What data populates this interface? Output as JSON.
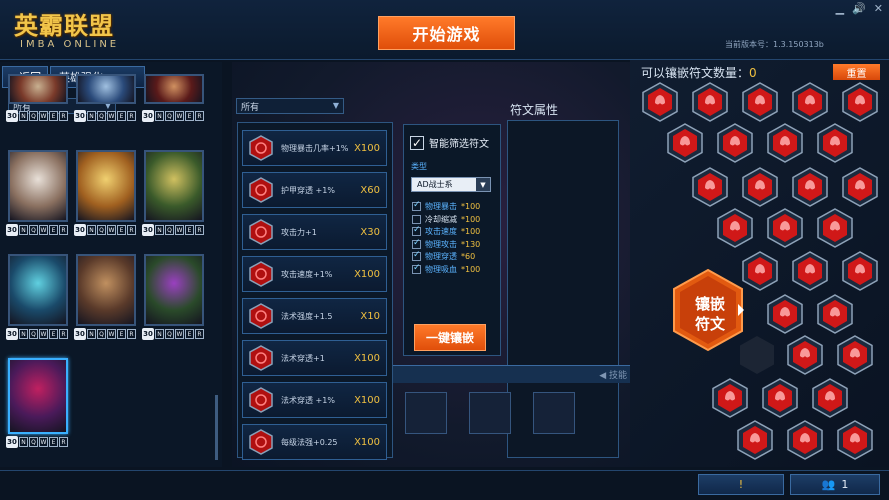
{
  "header": {
    "logo_title": "英霸联盟",
    "logo_sub": "IMBA ONLINE",
    "start_label": "开始游戏",
    "version": "当前版本号：1.3.150313b"
  },
  "nav": {
    "back_label": "返回",
    "tab_label": "英雄强化",
    "hero_filter": "所有"
  },
  "hero_keys": {
    "level": "30",
    "keys": [
      "N",
      "Q",
      "W",
      "E",
      "R"
    ]
  },
  "heroes": [
    {
      "name": "hero-1"
    },
    {
      "name": "hero-2"
    },
    {
      "name": "hero-3"
    },
    {
      "name": "hero-4"
    },
    {
      "name": "hero-5"
    },
    {
      "name": "hero-6"
    },
    {
      "name": "hero-7"
    },
    {
      "name": "hero-8"
    },
    {
      "name": "hero-9"
    },
    {
      "name": "hero-10"
    }
  ],
  "rune_filter": "所有",
  "runes": [
    {
      "name": "物理暴击几率+1%",
      "count": "X100"
    },
    {
      "name": "护甲穿透 +1%",
      "count": "X60"
    },
    {
      "name": "攻击力+1",
      "count": "X30"
    },
    {
      "name": "攻击速度+1%",
      "count": "X100"
    },
    {
      "name": "法术强度+1.5",
      "count": "X10"
    },
    {
      "name": "法术穿透+1",
      "count": "X100"
    },
    {
      "name": "法术穿透 +1%",
      "count": "X100"
    },
    {
      "name": "每级法强+0.25",
      "count": "X100"
    }
  ],
  "filter": {
    "smart_label": "智能筛选符文",
    "type_label": "类型",
    "type_value": "AD战士系",
    "options": [
      {
        "label": "物理暴击",
        "value": "*100",
        "checked": true
      },
      {
        "label": "冷却缩减",
        "value": "*100",
        "checked": false
      },
      {
        "label": "攻击速度",
        "value": "*100",
        "checked": true
      },
      {
        "label": "物理攻击",
        "value": "*130",
        "checked": true
      },
      {
        "label": "物理穿透",
        "value": "*60",
        "checked": true
      },
      {
        "label": "物理吸血",
        "value": "*100",
        "checked": true
      }
    ],
    "onekey_label": "一键镶嵌"
  },
  "attr_title": "符文属性",
  "runebar_text": "◀ 技能",
  "right": {
    "title": "可以镶嵌符文数量：",
    "count": "0",
    "reset_label": "重置",
    "inlay_label_1": "镶嵌",
    "inlay_label_2": "符文"
  },
  "bottom": {
    "alert_icon": "!",
    "friends_count": "1"
  },
  "colors": {
    "accent": "#f06018",
    "gold": "#f0c040",
    "rune_red": "#d01818",
    "frame_blue": "#2f5f93"
  }
}
